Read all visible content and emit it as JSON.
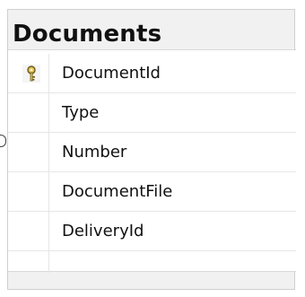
{
  "table": {
    "title": "Documents",
    "columns": [
      {
        "name": "DocumentId",
        "primary_key": true,
        "icon": "key-icon"
      },
      {
        "name": "Type",
        "primary_key": false
      },
      {
        "name": "Number",
        "primary_key": false
      },
      {
        "name": "DocumentFile",
        "primary_key": false
      },
      {
        "name": "DeliveryId",
        "primary_key": false
      }
    ]
  },
  "colors": {
    "header_bg": "#f1f1f1",
    "grid_bg": "#ffffff",
    "key_gold": "#d9b437"
  }
}
